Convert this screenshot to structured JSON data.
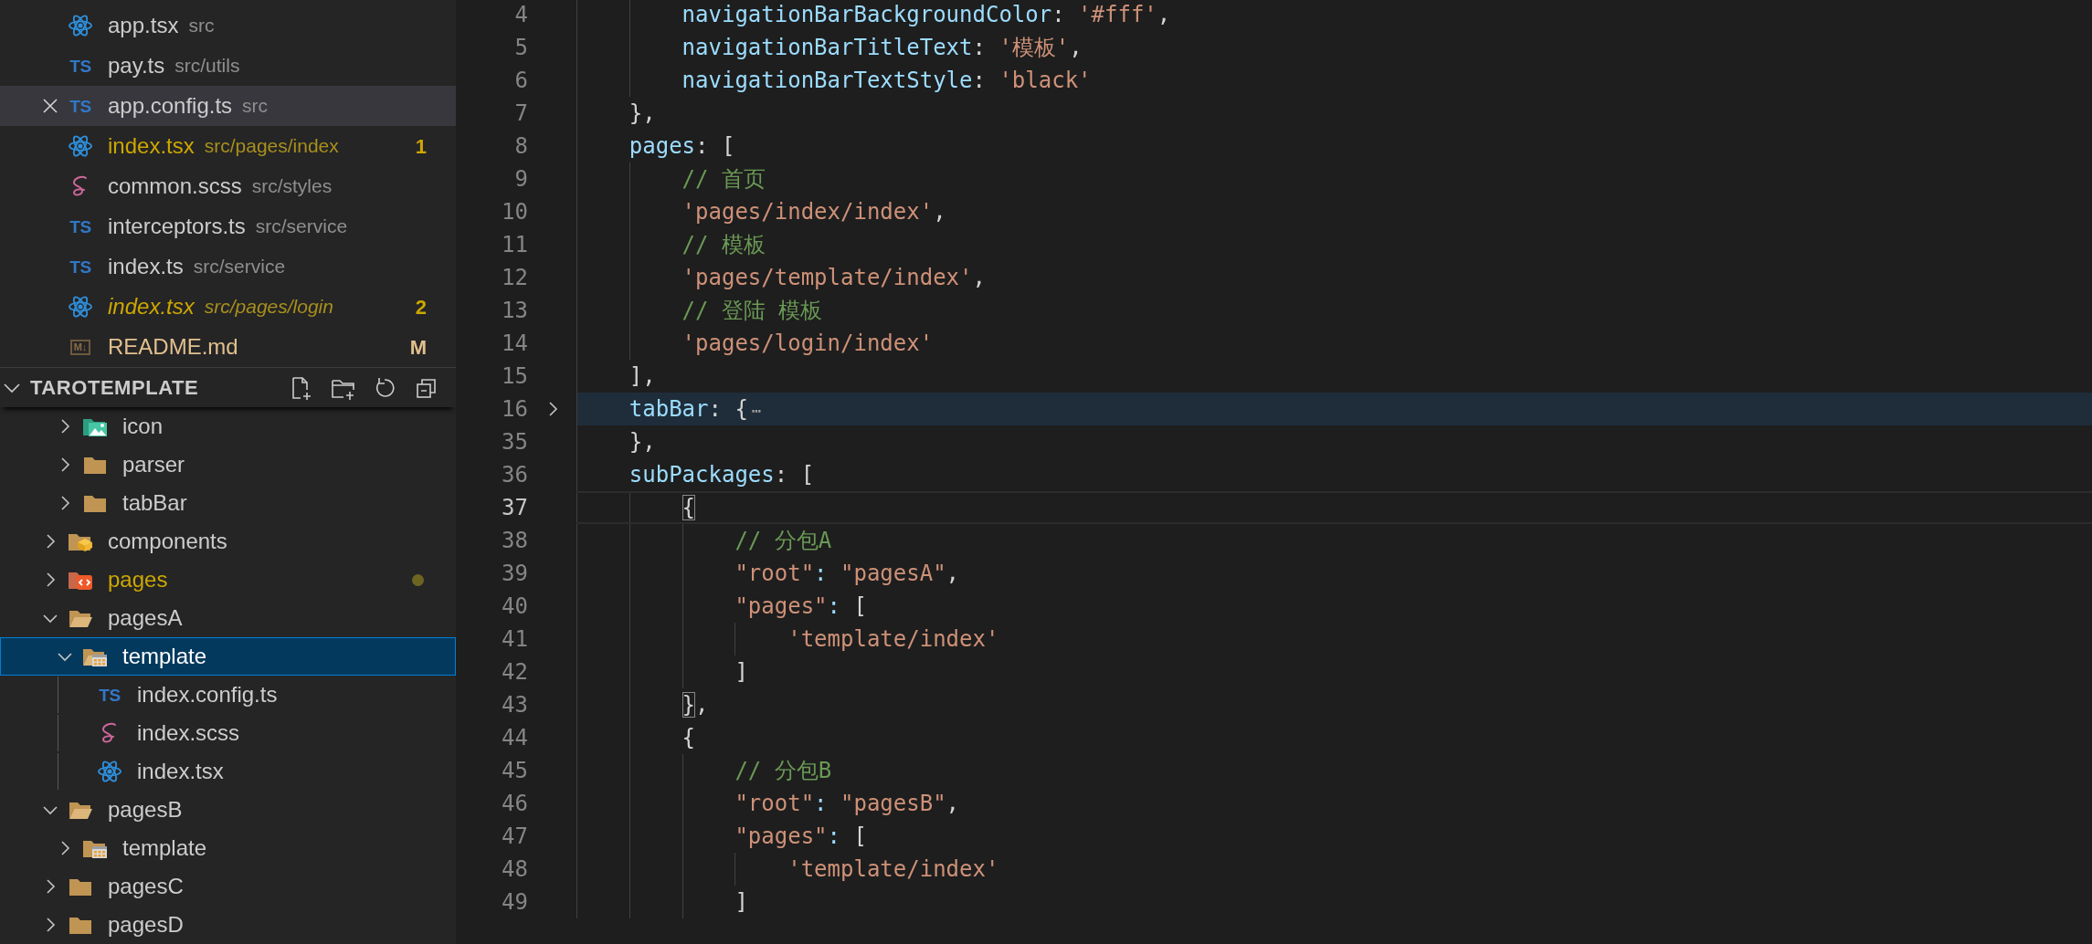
{
  "open_editors": [
    {
      "name": "app.tsx",
      "path": "src",
      "kind": "react",
      "selected": false,
      "italic": false,
      "problems": false,
      "modified": false
    },
    {
      "name": "pay.ts",
      "path": "src/utils",
      "kind": "ts",
      "icon_label": "TS",
      "selected": false,
      "italic": false,
      "problems": false,
      "modified": false
    },
    {
      "name": "app.config.ts",
      "path": "src",
      "kind": "ts",
      "icon_label": "TS",
      "selected": true,
      "italic": false,
      "problems": false,
      "modified": false
    },
    {
      "name": "index.tsx",
      "path": "src/pages/index",
      "kind": "react",
      "selected": false,
      "italic": false,
      "problems": true,
      "modified": false,
      "badge": "1"
    },
    {
      "name": "common.scss",
      "path": "src/styles",
      "kind": "scss",
      "selected": false,
      "italic": false,
      "problems": false,
      "modified": false
    },
    {
      "name": "interceptors.ts",
      "path": "src/service",
      "kind": "ts",
      "icon_label": "TS",
      "selected": false,
      "italic": false,
      "problems": false,
      "modified": false
    },
    {
      "name": "index.ts",
      "path": "src/service",
      "kind": "ts",
      "icon_label": "TS",
      "selected": false,
      "italic": false,
      "problems": false,
      "modified": false
    },
    {
      "name": "index.tsx",
      "path": "src/pages/login",
      "kind": "react",
      "selected": false,
      "italic": true,
      "problems": true,
      "modified": false,
      "badge": "2"
    },
    {
      "name": "README.md",
      "kind": "md",
      "icon_label": "M↓",
      "selected": false,
      "italic": false,
      "problems": false,
      "modified": true,
      "badge": "M"
    }
  ],
  "explorer": {
    "title": "TAROTEMPLATE",
    "expanded": true,
    "tree": [
      {
        "children": [
          {
            "name": "icon",
            "kind": "folder-image",
            "expanded": false,
            "selected": false,
            "problems": false
          },
          {
            "name": "parser",
            "kind": "folder",
            "expanded": false,
            "selected": false,
            "problems": false
          },
          {
            "name": "tabBar",
            "kind": "folder",
            "expanded": false,
            "selected": false,
            "problems": false
          }
        ]
      },
      {
        "name": "components",
        "kind": "folder-components",
        "expanded": false,
        "selected": false,
        "problems": false
      },
      {
        "name": "pages",
        "kind": "folder-pages",
        "expanded": false,
        "selected": false,
        "problems": true
      },
      {
        "name": "pagesA",
        "kind": "folder",
        "expanded": true,
        "selected": false,
        "problems": false,
        "children": [
          {
            "name": "template",
            "kind": "folder-template",
            "expanded": true,
            "selected": true,
            "problems": false,
            "children": [
              {
                "name": "index.config.ts",
                "kind": "ts",
                "icon_label": "TS",
                "selected": false,
                "problems": false
              },
              {
                "name": "index.scss",
                "kind": "scss",
                "selected": false,
                "problems": false
              },
              {
                "name": "index.tsx",
                "kind": "react",
                "selected": false,
                "problems": false
              }
            ]
          }
        ]
      },
      {
        "name": "pagesB",
        "kind": "folder",
        "expanded": true,
        "selected": false,
        "problems": false,
        "children": [
          {
            "name": "template",
            "kind": "folder-template",
            "expanded": false,
            "selected": false,
            "problems": false
          }
        ]
      },
      {
        "name": "pagesC",
        "kind": "folder",
        "expanded": false,
        "selected": false,
        "problems": false
      },
      {
        "name": "pagesD",
        "kind": "folder",
        "expanded": false,
        "selected": false,
        "problems": false
      }
    ]
  },
  "editor": {
    "lines": [
      {
        "number": "4",
        "folded": false,
        "current": false,
        "tokens": [
          {
            "kind": "prop",
            "text": "        navigationBarBackgroundColor"
          },
          {
            "kind": "punc",
            "text": ": "
          },
          {
            "kind": "str",
            "text": "'#fff'"
          },
          {
            "kind": "punc",
            "text": ","
          }
        ]
      },
      {
        "number": "5",
        "folded": false,
        "current": false,
        "tokens": [
          {
            "kind": "prop",
            "text": "        navigationBarTitleText"
          },
          {
            "kind": "punc",
            "text": ": "
          },
          {
            "kind": "str",
            "text": "'模板'"
          },
          {
            "kind": "punc",
            "text": ","
          }
        ]
      },
      {
        "number": "6",
        "folded": false,
        "current": false,
        "tokens": [
          {
            "kind": "prop",
            "text": "        navigationBarTextStyle"
          },
          {
            "kind": "punc",
            "text": ": "
          },
          {
            "kind": "str",
            "text": "'black'"
          }
        ]
      },
      {
        "number": "7",
        "folded": false,
        "current": false,
        "tokens": [
          {
            "kind": "punc",
            "text": "    },"
          }
        ]
      },
      {
        "number": "8",
        "folded": false,
        "current": false,
        "tokens": [
          {
            "kind": "prop",
            "text": "    pages"
          },
          {
            "kind": "punc",
            "text": ": ["
          }
        ]
      },
      {
        "number": "9",
        "folded": false,
        "current": false,
        "tokens": [
          {
            "kind": "comment",
            "text": "        // 首页"
          }
        ]
      },
      {
        "number": "10",
        "folded": false,
        "current": false,
        "tokens": [
          {
            "kind": "str",
            "text": "        'pages/index/index'"
          },
          {
            "kind": "punc",
            "text": ","
          }
        ]
      },
      {
        "number": "11",
        "folded": false,
        "current": false,
        "tokens": [
          {
            "kind": "comment",
            "text": "        // 模板"
          }
        ]
      },
      {
        "number": "12",
        "folded": false,
        "current": false,
        "tokens": [
          {
            "kind": "str",
            "text": "        'pages/template/index'"
          },
          {
            "kind": "punc",
            "text": ","
          }
        ]
      },
      {
        "number": "13",
        "folded": false,
        "current": false,
        "tokens": [
          {
            "kind": "comment",
            "text": "        // 登陆 模板"
          }
        ]
      },
      {
        "number": "14",
        "folded": false,
        "current": false,
        "tokens": [
          {
            "kind": "str",
            "text": "        'pages/login/index'"
          }
        ]
      },
      {
        "number": "15",
        "folded": false,
        "current": false,
        "tokens": [
          {
            "kind": "punc",
            "text": "    ],"
          }
        ]
      },
      {
        "number": "16",
        "folded": true,
        "current": false,
        "tokens": [
          {
            "kind": "prop",
            "text": "    tabBar"
          },
          {
            "kind": "punc",
            "text": ": {"
          },
          {
            "kind": "fold",
            "text": "⋯"
          }
        ]
      },
      {
        "number": "35",
        "folded": false,
        "current": false,
        "tokens": [
          {
            "kind": "punc",
            "text": "    },"
          }
        ]
      },
      {
        "number": "36",
        "folded": false,
        "current": false,
        "tokens": [
          {
            "kind": "prop",
            "text": "    subPackages"
          },
          {
            "kind": "punc",
            "text": ": ["
          }
        ]
      },
      {
        "number": "37",
        "folded": false,
        "current": true,
        "tokens": [
          {
            "kind": "match",
            "text": "        {"
          }
        ]
      },
      {
        "number": "38",
        "folded": false,
        "current": false,
        "tokens": [
          {
            "kind": "comment",
            "text": "            // 分包A"
          }
        ]
      },
      {
        "number": "39",
        "folded": false,
        "current": false,
        "tokens": [
          {
            "kind": "str",
            "text": "            \"root\""
          },
          {
            "kind": "prop",
            "text": ": "
          },
          {
            "kind": "str",
            "text": "\"pagesA\""
          },
          {
            "kind": "punc",
            "text": ","
          }
        ]
      },
      {
        "number": "40",
        "folded": false,
        "current": false,
        "tokens": [
          {
            "kind": "str",
            "text": "            \"pages\""
          },
          {
            "kind": "prop",
            "text": ": "
          },
          {
            "kind": "punc",
            "text": "["
          }
        ]
      },
      {
        "number": "41",
        "folded": false,
        "current": false,
        "tokens": [
          {
            "kind": "str",
            "text": "                'template/index'"
          }
        ]
      },
      {
        "number": "42",
        "folded": false,
        "current": false,
        "tokens": [
          {
            "kind": "punc",
            "text": "            ]"
          }
        ]
      },
      {
        "number": "43",
        "folded": false,
        "current": false,
        "tokens": [
          {
            "kind": "match",
            "text": "        }"
          },
          {
            "kind": "punc",
            "text": ","
          }
        ]
      },
      {
        "number": "44",
        "folded": false,
        "current": false,
        "tokens": [
          {
            "kind": "punc",
            "text": "        {"
          }
        ]
      },
      {
        "number": "45",
        "folded": false,
        "current": false,
        "tokens": [
          {
            "kind": "comment",
            "text": "            // 分包B"
          }
        ]
      },
      {
        "number": "46",
        "folded": false,
        "current": false,
        "tokens": [
          {
            "kind": "str",
            "text": "            \"root\""
          },
          {
            "kind": "prop",
            "text": ": "
          },
          {
            "kind": "str",
            "text": "\"pagesB\""
          },
          {
            "kind": "punc",
            "text": ","
          }
        ]
      },
      {
        "number": "47",
        "folded": false,
        "current": false,
        "tokens": [
          {
            "kind": "str",
            "text": "            \"pages\""
          },
          {
            "kind": "prop",
            "text": ": "
          },
          {
            "kind": "punc",
            "text": "["
          }
        ]
      },
      {
        "number": "48",
        "folded": false,
        "current": false,
        "tokens": [
          {
            "kind": "str",
            "text": "                'template/index'"
          }
        ]
      },
      {
        "number": "49",
        "folded": false,
        "current": false,
        "tokens": [
          {
            "kind": "punc",
            "text": "            ]"
          }
        ]
      }
    ]
  }
}
